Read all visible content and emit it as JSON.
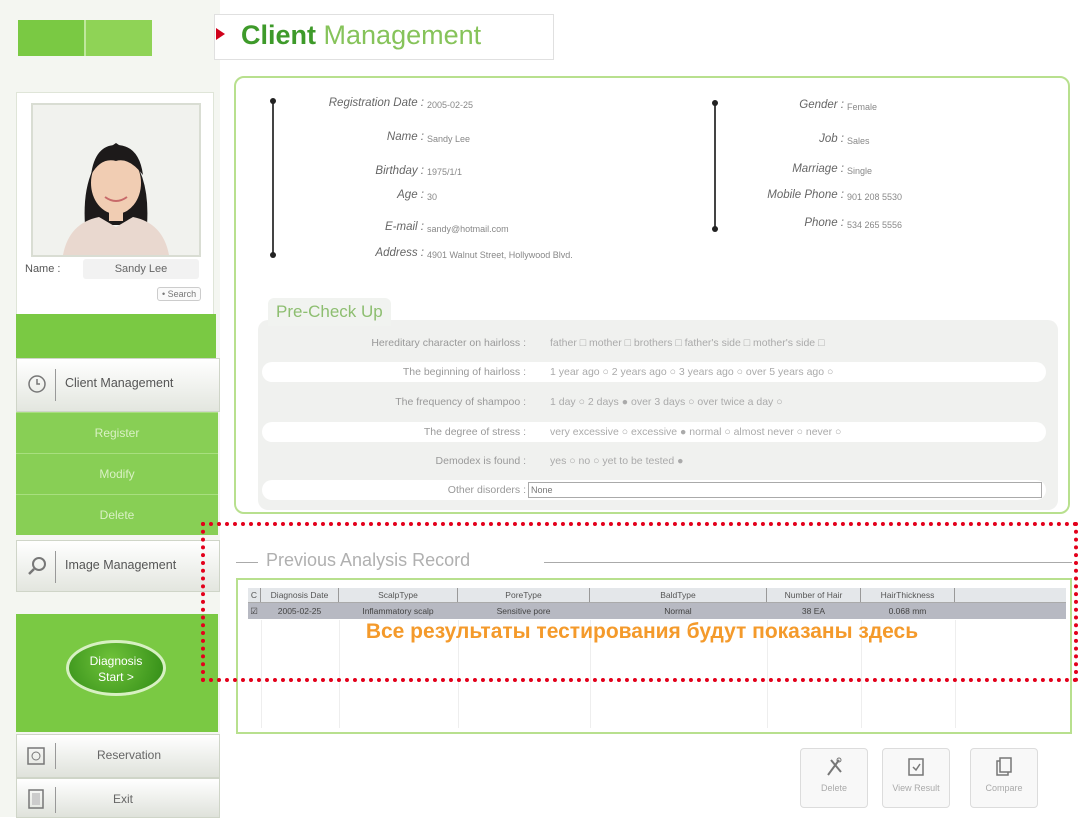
{
  "header": {
    "title_bold": "Client",
    "title_rest": "Management"
  },
  "sidebar": {
    "profile": {
      "name_label": "Name :",
      "name_value": "Sandy Lee",
      "search_label": "• Search"
    },
    "menu": [
      {
        "label": "Client Management",
        "icon": "clock-icon"
      },
      {
        "label": "Image Management",
        "icon": "magnifier-icon"
      }
    ],
    "submenu": [
      "Register",
      "Modify",
      "Delete"
    ],
    "diagnosis_button": {
      "line1": "Diagnosis",
      "line2": "Start >"
    },
    "bottom": [
      {
        "label": "Reservation",
        "icon": "calendar-icon"
      },
      {
        "label": "Exit",
        "icon": "exit-door-icon"
      }
    ]
  },
  "client_info": {
    "left": [
      {
        "label": "Registration Date :",
        "value": "2005-02-25"
      },
      {
        "label": "Name :",
        "value": "Sandy Lee"
      },
      {
        "label": "Birthday :",
        "value": "1975/1/1"
      },
      {
        "label": "Age :",
        "value": "30"
      },
      {
        "label": "E-mail :",
        "value": "sandy@hotmail.com"
      },
      {
        "label": "Address :",
        "value": "4901 Walnut Street, Hollywood Blvd."
      }
    ],
    "right": [
      {
        "label": "Gender :",
        "value": "Female"
      },
      {
        "label": "Job :",
        "value": "Sales"
      },
      {
        "label": "Marriage :",
        "value": "Single"
      },
      {
        "label": "Mobile Phone :",
        "value": "901 208 5530"
      },
      {
        "label": "Phone :",
        "value": "534 265 5556"
      }
    ]
  },
  "precheck": {
    "title": "Pre-Check Up",
    "rows": [
      {
        "question": "Hereditary character on hairloss :",
        "options": "father □  mother □  brothers □  father's side □  mother's side □"
      },
      {
        "question": "The beginning of hairloss :",
        "options": "1 year ago ○  2 years ago ○  3 years ago ○  over 5 years ago ○"
      },
      {
        "question": "The frequency of shampoo :",
        "options": "1 day ○  2 days ●  over 3 days ○  over twice a day ○"
      },
      {
        "question": "The degree of stress :",
        "options": "very excessive ○  excessive ●  normal ○  almost never ○  never ○"
      },
      {
        "question": "Demodex is found :",
        "options": "yes ○  no ○  yet to be tested ●"
      }
    ],
    "other_label": "Other disorders :",
    "other_value": "None"
  },
  "analysis": {
    "title": "Previous Analysis Record",
    "columns": [
      "C",
      "Diagnosis Date",
      "ScalpType",
      "PoreType",
      "BaldType",
      "Number of Hair",
      "HairThickness"
    ],
    "rows": [
      {
        "checked": "☑",
        "date": "2005-02-25",
        "scalp": "Inflammatory scalp",
        "pore": "Sensitive pore",
        "bald": "Normal",
        "hair_count": "38  EA",
        "thickness": "0.068  mm"
      }
    ]
  },
  "annotation": {
    "text": "Все результаты тестирования будут показаны здесь",
    "border_color": "#e3001b",
    "text_color": "#f49a2b"
  },
  "actions": [
    {
      "label": "Delete",
      "icon": "tools-icon"
    },
    {
      "label": "View Result",
      "icon": "view-result-icon"
    },
    {
      "label": "Compare",
      "icon": "compare-icon"
    }
  ],
  "colors": {
    "accent_green": "#7ac943",
    "title_green": "#3e9a2a",
    "marker_red": "#d0021b"
  }
}
